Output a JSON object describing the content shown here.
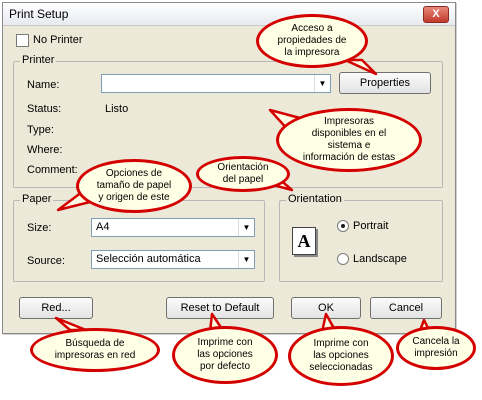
{
  "window": {
    "title": "Print Setup",
    "close_glyph": "X"
  },
  "no_printer": {
    "label": "No Printer",
    "checked": false
  },
  "printer": {
    "group_title": "Printer",
    "name_label": "Name:",
    "name_value": "",
    "properties_button": "Properties",
    "status_label": "Status:",
    "status_value": "Listo",
    "type_label": "Type:",
    "where_label": "Where:",
    "comment_label": "Comment:"
  },
  "paper": {
    "group_title": "Paper",
    "size_label": "Size:",
    "size_value": "A4",
    "source_label": "Source:",
    "source_value": "Selección automática"
  },
  "orientation": {
    "group_title": "Orientation",
    "portrait_label": "Portrait",
    "landscape_label": "Landscape",
    "selected": "portrait",
    "page_glyph": "A"
  },
  "buttons": {
    "network": "Red...",
    "reset": "Reset to Default",
    "ok": "OK",
    "cancel": "Cancel"
  },
  "callouts": {
    "properties": "Acceso a\npropiedades de\nla impresora",
    "printers": "Impresoras\ndisponibles en el\nsistema e\ninformación de estas",
    "paper": "Opciones de\ntamaño de papel\ny origen de este",
    "orientation": "Orientación\ndel papel",
    "network": "Búsqueda de\nimpresoras en red",
    "reset": "Imprime con\nlas opciones\npor defecto",
    "ok": "Imprime con\nlas opciones\nseleccionadas",
    "cancel": "Cancela la\nimpresión"
  },
  "colors": {
    "callout_border": "#d40000",
    "callout_fill": "#ffffe6",
    "dialog_bg": "#ece9d8"
  }
}
